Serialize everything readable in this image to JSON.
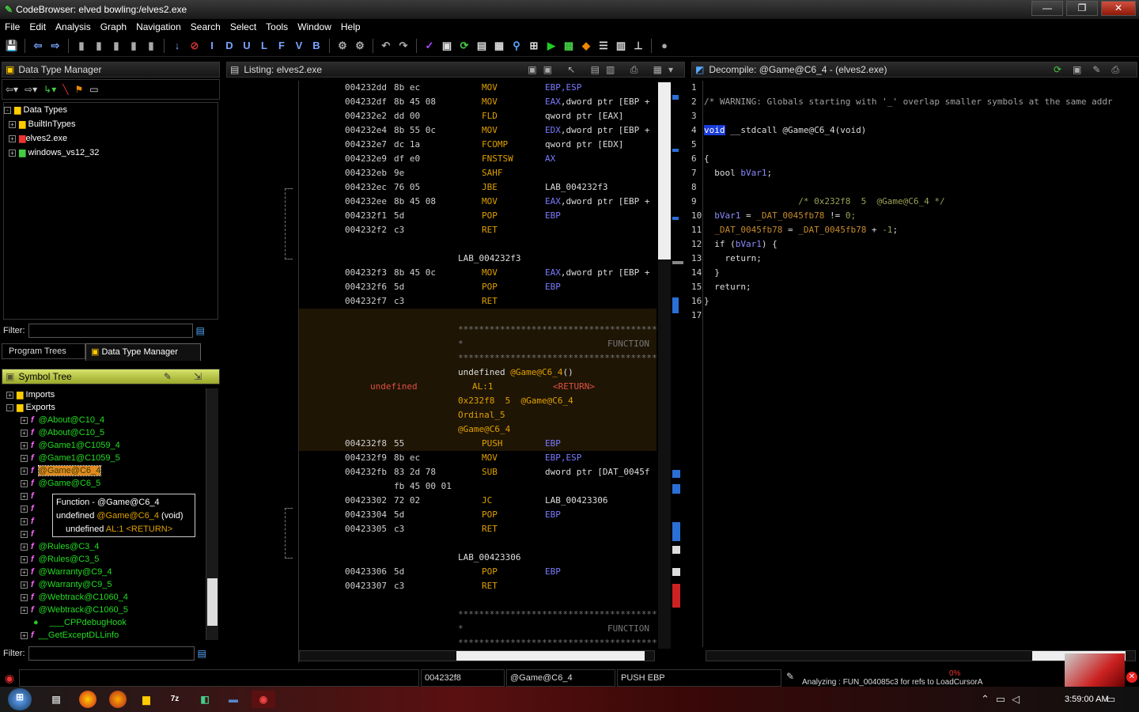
{
  "window": {
    "title": "CodeBrowser: elved bowling:/elves2.exe",
    "min": "—",
    "max": "❐",
    "close": "✕"
  },
  "menu": [
    "File",
    "Edit",
    "Analysis",
    "Graph",
    "Navigation",
    "Search",
    "Select",
    "Tools",
    "Window",
    "Help"
  ],
  "toolbar": {
    "letters": [
      "I",
      "D",
      "U",
      "L",
      "F",
      "V",
      "B"
    ]
  },
  "dtm": {
    "title": "Data Type Manager",
    "root": "Data Types",
    "items": [
      "BuiltInTypes",
      "elves2.exe",
      "windows_vs12_32"
    ],
    "filter_label": "Filter:",
    "tabs": [
      "Program Trees",
      "Data Type Manager"
    ]
  },
  "symtree": {
    "title": "Symbol Tree",
    "imports": "Imports",
    "exports": "Exports",
    "items": [
      "@About@C10_4",
      "@About@C10_5",
      "@Game1@C1059_4",
      "@Game1@C1059_5",
      "@Game@C6_4",
      "@Game@C6_5",
      "@Rules@C3_4",
      "@Rules@C3_5",
      "@Warranty@C9_4",
      "@Warranty@C9_5",
      "@Webtrack@C1060_4",
      "@Webtrack@C1060_5",
      "___CPPdebugHook",
      "__GetExceptDLLinfo"
    ],
    "filter_label": "Filter:",
    "tooltip": {
      "line1": "Function - @Game@C6_4",
      "line2a": "undefined ",
      "line2b": "@Game@C6_4",
      "line2c": " (void)",
      "line3a": "undefined ",
      "line3b": "AL:1",
      "line3c": " <RETURN>"
    }
  },
  "listing": {
    "title": "Listing:  elves2.exe",
    "rows": [
      {
        "a": "004232dd",
        "b": "8b ec",
        "m": "MOV",
        "o1": "EBP,ESP",
        "o2": ""
      },
      {
        "a": "004232df",
        "b": "8b 45 08",
        "m": "MOV",
        "o1": "EAX",
        "o2": ",dword ptr [EBP +"
      },
      {
        "a": "004232e2",
        "b": "dd 00",
        "m": "FLD",
        "o1": "",
        "o2": "qword ptr [EAX]"
      },
      {
        "a": "004232e4",
        "b": "8b 55 0c",
        "m": "MOV",
        "o1": "EDX",
        "o2": ",dword ptr [EBP +"
      },
      {
        "a": "004232e7",
        "b": "dc 1a",
        "m": "FCOMP",
        "o1": "",
        "o2": "qword ptr [EDX]"
      },
      {
        "a": "004232e9",
        "b": "df e0",
        "m": "FNSTSW",
        "o1": "AX",
        "o2": ""
      },
      {
        "a": "004232eb",
        "b": "9e",
        "m": "SAHF",
        "o1": "",
        "o2": ""
      },
      {
        "a": "004232ec",
        "b": "76 05",
        "m": "JBE",
        "o1": "",
        "o2": "LAB_004232f3"
      },
      {
        "a": "004232ee",
        "b": "8b 45 08",
        "m": "MOV",
        "o1": "EAX",
        "o2": ",dword ptr [EBP +"
      },
      {
        "a": "004232f1",
        "b": "5d",
        "m": "POP",
        "o1": "EBP",
        "o2": ""
      },
      {
        "a": "004232f2",
        "b": "c3",
        "m": "RET",
        "o1": "",
        "o2": ""
      }
    ],
    "label1": "LAB_004232f3",
    "rows2": [
      {
        "a": "004232f3",
        "b": "8b 45 0c",
        "m": "MOV",
        "o1": "EAX",
        "o2": ",dword ptr [EBP +"
      },
      {
        "a": "004232f6",
        "b": "5d",
        "m": "POP",
        "o1": "EBP",
        "o2": ""
      },
      {
        "a": "004232f7",
        "b": "c3",
        "m": "RET",
        "o1": "",
        "o2": ""
      }
    ],
    "stars": "**************************************************************",
    "function_kw": "FUNCTION",
    "func_sig": "undefined @Game@C6_4()",
    "ret_type": "undefined",
    "ret_reg": "AL:1",
    "ret_tag": "<RETURN>",
    "xref": "0x232f8  5  @Game@C6_4",
    "ordinal": "Ordinal_5",
    "func_name": "@Game@C6_4",
    "rows3": [
      {
        "a": "004232f8",
        "b": "55",
        "m": "PUSH",
        "o1": "EBP",
        "o2": ""
      },
      {
        "a": "004232f9",
        "b": "8b ec",
        "m": "MOV",
        "o1": "EBP,ESP",
        "o2": ""
      },
      {
        "a": "004232fb",
        "b": "83 2d 78",
        "m": "SUB",
        "o1": "",
        "o2": "dword ptr [DAT_0045f"
      },
      {
        "a": "",
        "b": "fb 45 00 01",
        "m": "",
        "o1": "",
        "o2": ""
      },
      {
        "a": "00423302",
        "b": "72 02",
        "m": "JC",
        "o1": "",
        "o2": "LAB_00423306"
      },
      {
        "a": "00423304",
        "b": "5d",
        "m": "POP",
        "o1": "EBP",
        "o2": ""
      },
      {
        "a": "00423305",
        "b": "c3",
        "m": "RET",
        "o1": "",
        "o2": ""
      }
    ],
    "label2": "LAB_00423306",
    "rows4": [
      {
        "a": "00423306",
        "b": "5d",
        "m": "POP",
        "o1": "EBP",
        "o2": ""
      },
      {
        "a": "00423307",
        "b": "c3",
        "m": "RET",
        "o1": "",
        "o2": ""
      }
    ]
  },
  "decompile": {
    "title": "Decompile: @Game@C6_4 -  (elves2.exe)",
    "lines": [
      "",
      "/* WARNING: Globals starting with '_' overlap smaller symbols at the same addr",
      "",
      "__stdcall @Game@C6_4(void)",
      "",
      "{",
      "  bool bVar1;",
      "",
      "                  /* 0x232f8  5  @Game@C6_4 */",
      "  bVar1 = _DAT_0045fb78 != 0;",
      "  _DAT_0045fb78 = _DAT_0045fb78 + -1;",
      "  if (bVar1) {",
      "    return;",
      "  }",
      "  return;",
      "}",
      ""
    ],
    "void_kw": "void",
    "line_numbers": [
      "1",
      "2",
      "3",
      "4",
      "5",
      "6",
      "7",
      "8",
      "9",
      "10",
      "11",
      "12",
      "13",
      "14",
      "15",
      "16",
      "17"
    ]
  },
  "status": {
    "addr": "004232f8",
    "func": "@Game@C6_4",
    "instr": "PUSH EBP",
    "progress": "0%",
    "analyzing": "Analyzing : FUN_004085c3 for refs to LoadCursorA"
  },
  "taskbar": {
    "time": "3:59:00 AM"
  }
}
